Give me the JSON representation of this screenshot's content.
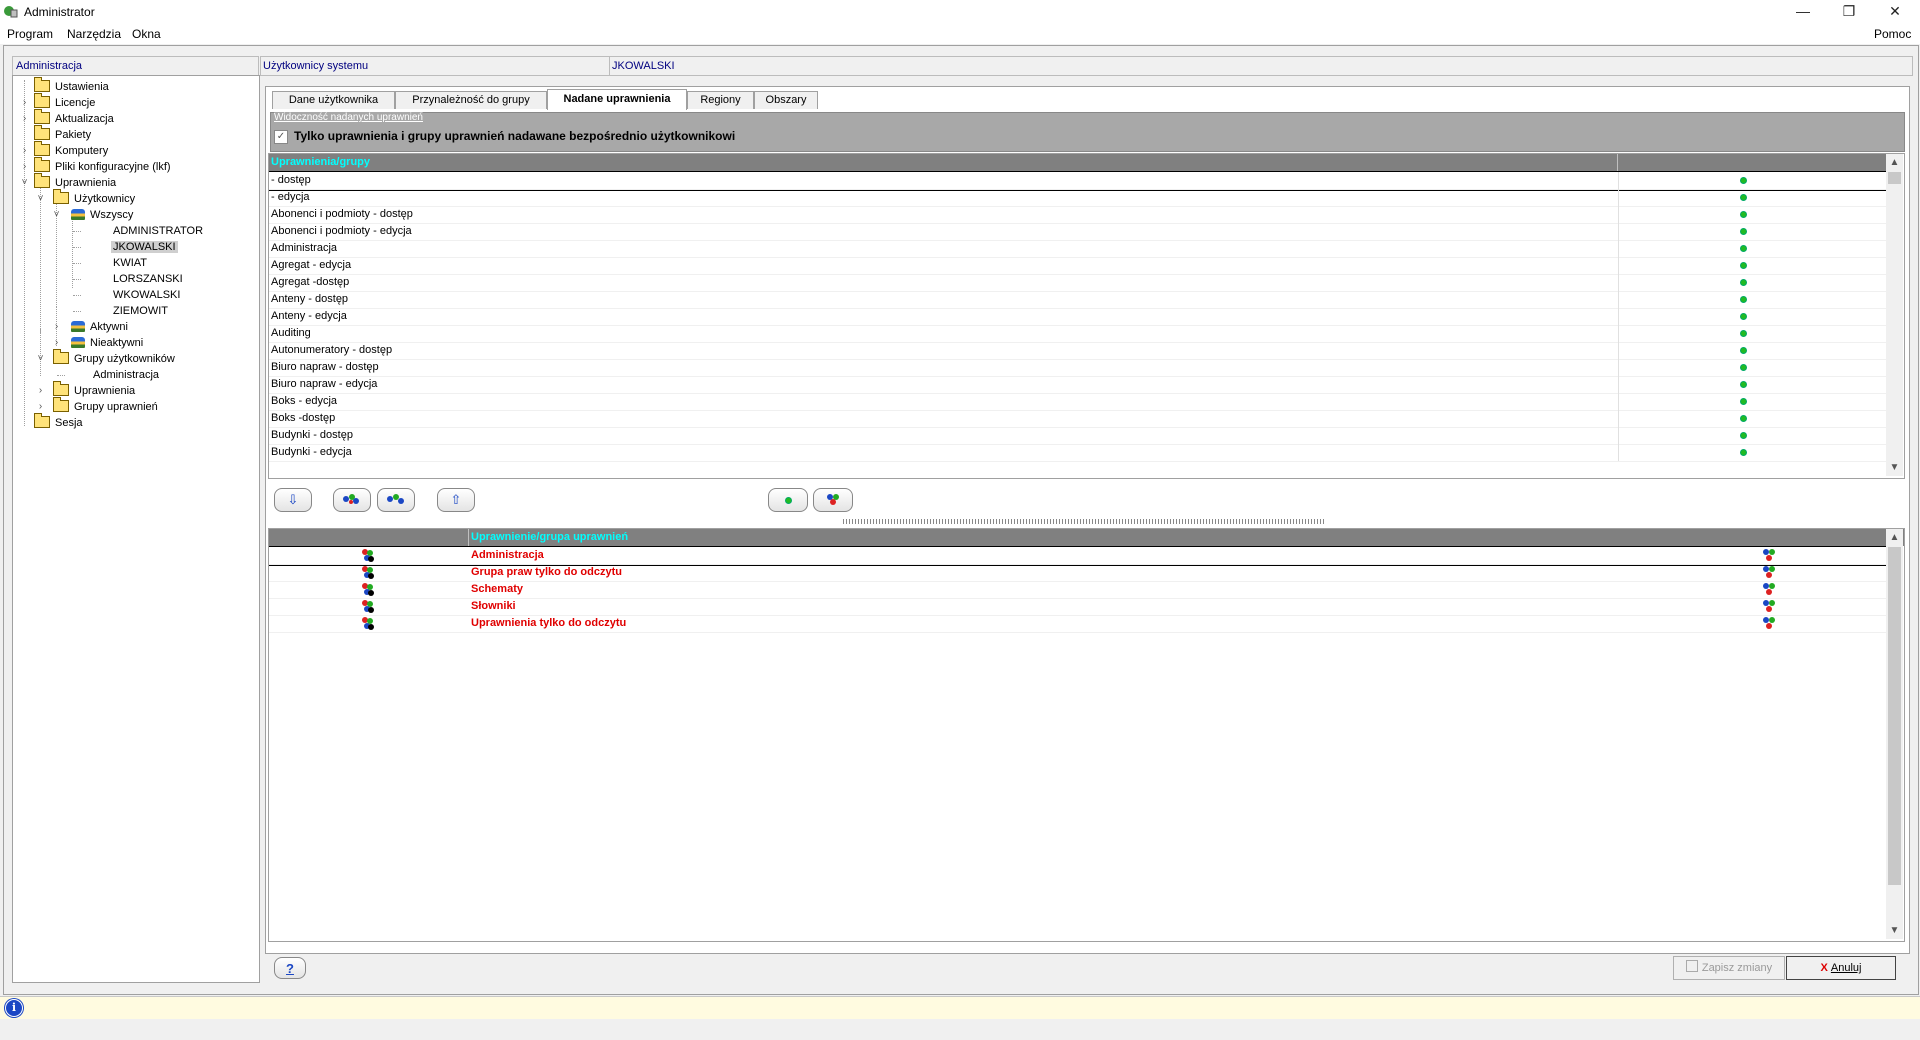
{
  "window": {
    "title": "Administrator",
    "minimize": "—",
    "restore": "❐",
    "close": "✕"
  },
  "menu": {
    "items": [
      "Program",
      "Narzędzia",
      "Okna"
    ],
    "help": "Pomoc"
  },
  "left_panel": {
    "header": "Administracja",
    "tree": [
      {
        "label": "Ustawienia"
      },
      {
        "label": "Licencje"
      },
      {
        "label": "Aktualizacja"
      },
      {
        "label": "Pakiety"
      },
      {
        "label": "Komputery"
      },
      {
        "label": "Pliki konfiguracyjne (lkf)"
      },
      {
        "label": "Uprawnienia"
      },
      {
        "label": "Użytkownicy"
      },
      {
        "label": "Wszyscy"
      },
      {
        "label": "ADMINISTRATOR"
      },
      {
        "label": "JKOWALSKI"
      },
      {
        "label": "KWIAT"
      },
      {
        "label": "LORSZANSKI"
      },
      {
        "label": "WKOWALSKI"
      },
      {
        "label": "ZIEMOWIT"
      },
      {
        "label": "Aktywni"
      },
      {
        "label": "Nieaktywni"
      },
      {
        "label": "Grupy użytkowników"
      },
      {
        "label": "Administracja"
      },
      {
        "label": "Uprawnienia"
      },
      {
        "label": "Grupy uprawnień"
      },
      {
        "label": "Sesja"
      }
    ]
  },
  "header": {
    "section": "Użytkownicy systemu",
    "user": "JKOWALSKI"
  },
  "tabs": [
    {
      "label": "Dane użytkownika"
    },
    {
      "label": "Przynależność do grupy"
    },
    {
      "label": "Nadane uprawnienia"
    },
    {
      "label": "Regiony"
    },
    {
      "label": "Obszary"
    }
  ],
  "active_tab": "Nadane uprawnienia",
  "filter": {
    "title": "Widoczność nadanych uprawnień",
    "checkbox_label": "Tylko uprawnienia i grupy uprawnień nadawane bezpośrednio użytkownikowi",
    "checked": true
  },
  "permissions_grid": {
    "header": "Uprawnienia/grupy",
    "rows": [
      " - dostęp",
      " - edycja",
      "Abonenci i podmioty - dostęp",
      "Abonenci i podmioty - edycja",
      "Administracja",
      "Agregat - edycja",
      "Agregat -dostęp",
      "Anteny - dostęp",
      "Anteny - edycja",
      "Auditing",
      "Autonumeratory - dostęp",
      "Biuro napraw - dostęp",
      "Biuro napraw - edycja",
      "Boks - edycja",
      "Boks -dostęp",
      "Budynki - dostęp",
      "Budynki - edycja"
    ]
  },
  "toolbar": {
    "down": "⇩",
    "up": "⇧"
  },
  "groups_grid": {
    "header": "Uprawnienie/grupa uprawnień",
    "rows": [
      "Administracja",
      "Grupa praw tylko do odczytu",
      "Schematy",
      "Słowniki",
      "Uprawnienia tylko do odczytu"
    ]
  },
  "footer": {
    "help": "?",
    "save": "Zapisz zmiany",
    "cancel": "Anuluj"
  },
  "status": {
    "icon": "i"
  },
  "colors": {
    "grid_header_bg": "#808080",
    "grid_header_text": "#00ffff",
    "group_name": "#e00000",
    "link_blue": "#000080"
  }
}
